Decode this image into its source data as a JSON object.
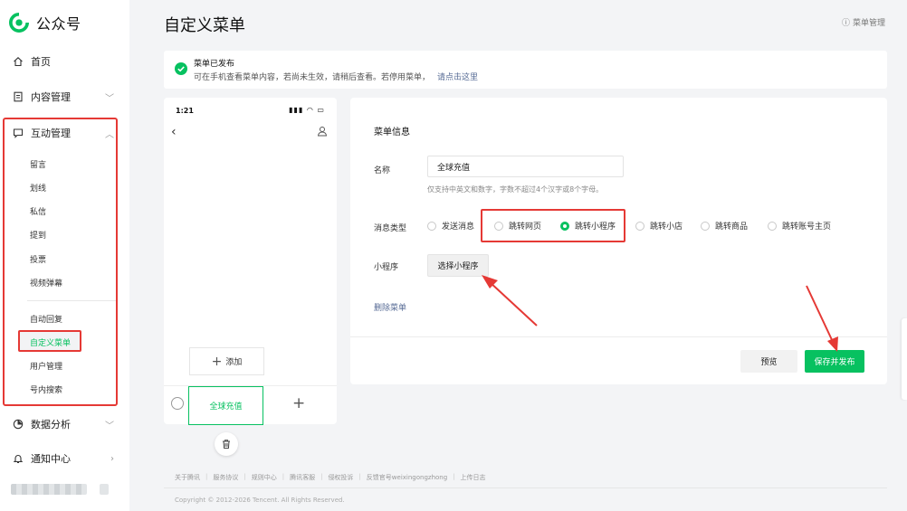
{
  "app": {
    "name": "公众号"
  },
  "sidebar": {
    "items": [
      {
        "label": "首页",
        "icon": "home-icon"
      },
      {
        "label": "内容管理",
        "icon": "document-icon"
      },
      {
        "label": "互动管理",
        "icon": "chat-icon"
      },
      {
        "label": "数据分析",
        "icon": "chart-icon"
      },
      {
        "label": "通知中心",
        "icon": "bell-icon"
      }
    ],
    "sub_items": [
      "留言",
      "划线",
      "私信",
      "提到",
      "投票",
      "视频弹幕",
      "自动回复",
      "自定义菜单",
      "用户管理",
      "号内搜索"
    ]
  },
  "header": {
    "title": "自定义菜单",
    "help": "菜单管理"
  },
  "notice": {
    "title": "菜单已发布",
    "desc": "可在手机查看菜单内容，若尚未生效，请稍后查看。若停用菜单，",
    "link": "请点击这里"
  },
  "phone": {
    "time": "1:21",
    "add_label": "添加",
    "menu_item": "全球充值"
  },
  "form": {
    "section_title": "菜单信息",
    "name_label": "名称",
    "name_value": "全球充值",
    "name_hint": "仅支持中英文和数字，字数不超过4个汉字或8个字母。",
    "type_label": "消息类型",
    "types": [
      "发送消息",
      "跳转网页",
      "跳转小程序",
      "跳转小店",
      "跳转商品",
      "跳转账号主页"
    ],
    "selected_type": "跳转小程序",
    "miniprogram_label": "小程序",
    "choose_button": "选择小程序",
    "delete_link": "删除菜单",
    "preview_button": "预览",
    "publish_button": "保存并发布"
  },
  "footer": {
    "links": [
      "关于腾讯",
      "服务协议",
      "规则中心",
      "腾讯客服",
      "侵权投诉",
      "反馈官号weixingongzhong",
      "上传日志"
    ],
    "copyright": "Copyright © 2012-2026 Tencent. All Rights Reserved."
  },
  "colors": {
    "accent": "#07c160",
    "highlight": "#e53935",
    "link": "#576b95"
  }
}
